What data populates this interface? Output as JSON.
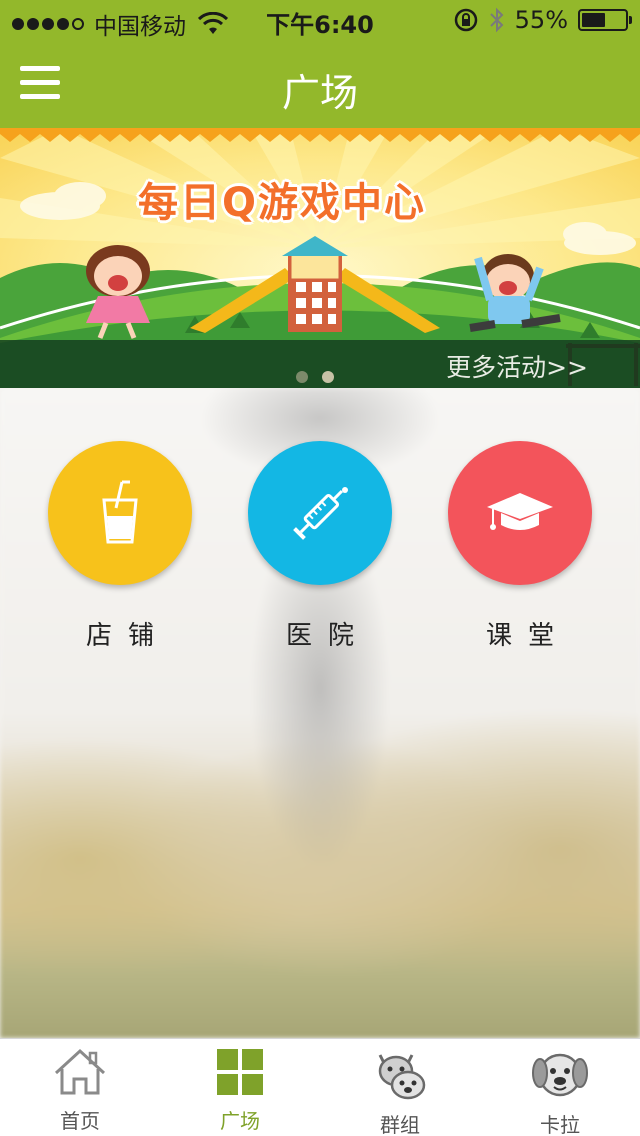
{
  "status_bar": {
    "carrier": "中国移动",
    "time": "下午6:40",
    "battery_text": "55%",
    "battery_level": 0.55,
    "signal_bars": 4
  },
  "nav": {
    "title": "广场",
    "menu_icon": "hamburger-menu-icon"
  },
  "banner": {
    "title": "每日Q游戏中心",
    "more_link": "更多活动>>",
    "page_count": 2,
    "active_page": 1
  },
  "categories": [
    {
      "label": "店铺",
      "icon": "drink-cup-icon",
      "color": "#f7c21b"
    },
    {
      "label": "医院",
      "icon": "syringe-icon",
      "color": "#13b7e4"
    },
    {
      "label": "课堂",
      "icon": "graduation-cap-icon",
      "color": "#f3545b"
    }
  ],
  "tabbar": {
    "items": [
      {
        "label": "首页",
        "icon": "home-icon"
      },
      {
        "label": "广场",
        "icon": "grid-icon"
      },
      {
        "label": "群组",
        "icon": "pets-group-icon"
      },
      {
        "label": "卡拉",
        "icon": "dog-face-icon"
      }
    ],
    "active_index": 1
  },
  "colors": {
    "brand_green": "#93b82b",
    "active_tab": "#7fa22a"
  }
}
